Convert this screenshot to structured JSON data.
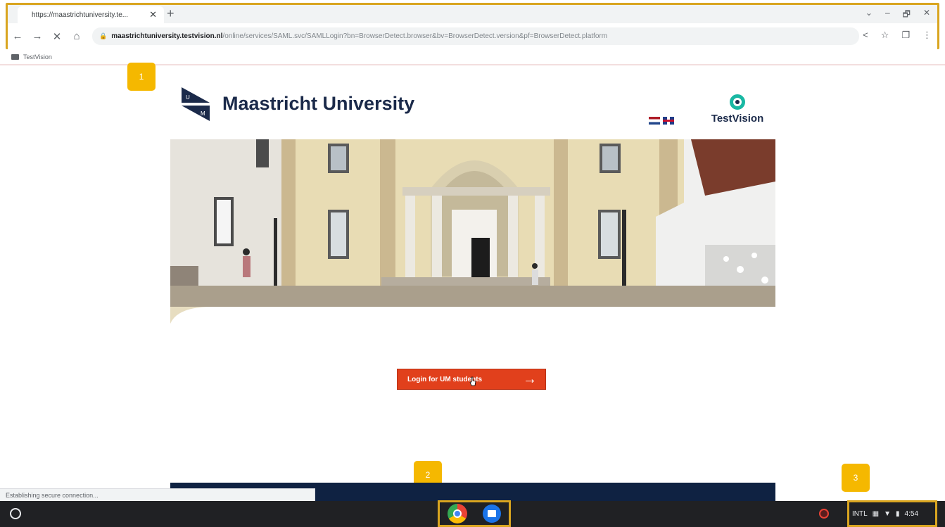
{
  "browser": {
    "tab_title": "https://maastrichtuniversity.te...",
    "tab_close": "✕",
    "new_tab": "+",
    "window_controls": [
      "⌄",
      "–",
      "🗗",
      "✕"
    ],
    "nav": {
      "back": "←",
      "forward": "→",
      "stop": "✕",
      "home": "⌂"
    },
    "url_host": "maastrichtuniversity.testvision.nl",
    "url_path": "/online/services/SAML.svc/SAMLLogin?bn=BrowserDetect.browser&bv=BrowserDetect.version&pf=BrowserDetect.platform",
    "toolbar_right": [
      "<",
      "☆",
      "❐",
      "⋮"
    ],
    "bookmark": "TestVision"
  },
  "annotations": {
    "badge1": "1",
    "badge2": "2",
    "badge3": "3"
  },
  "page": {
    "university_name": "Maastricht University",
    "testvision_name": "TestVision",
    "login_button": "Login for UM students",
    "login_arrow": "→"
  },
  "status": "Establishing secure connection...",
  "tray": {
    "input_method": "INTL",
    "time": "4:54"
  },
  "colors": {
    "accent_orange": "#e1401c",
    "navy": "#1b2a4a",
    "badge": "#f5b800",
    "highlight": "#d9a520"
  }
}
